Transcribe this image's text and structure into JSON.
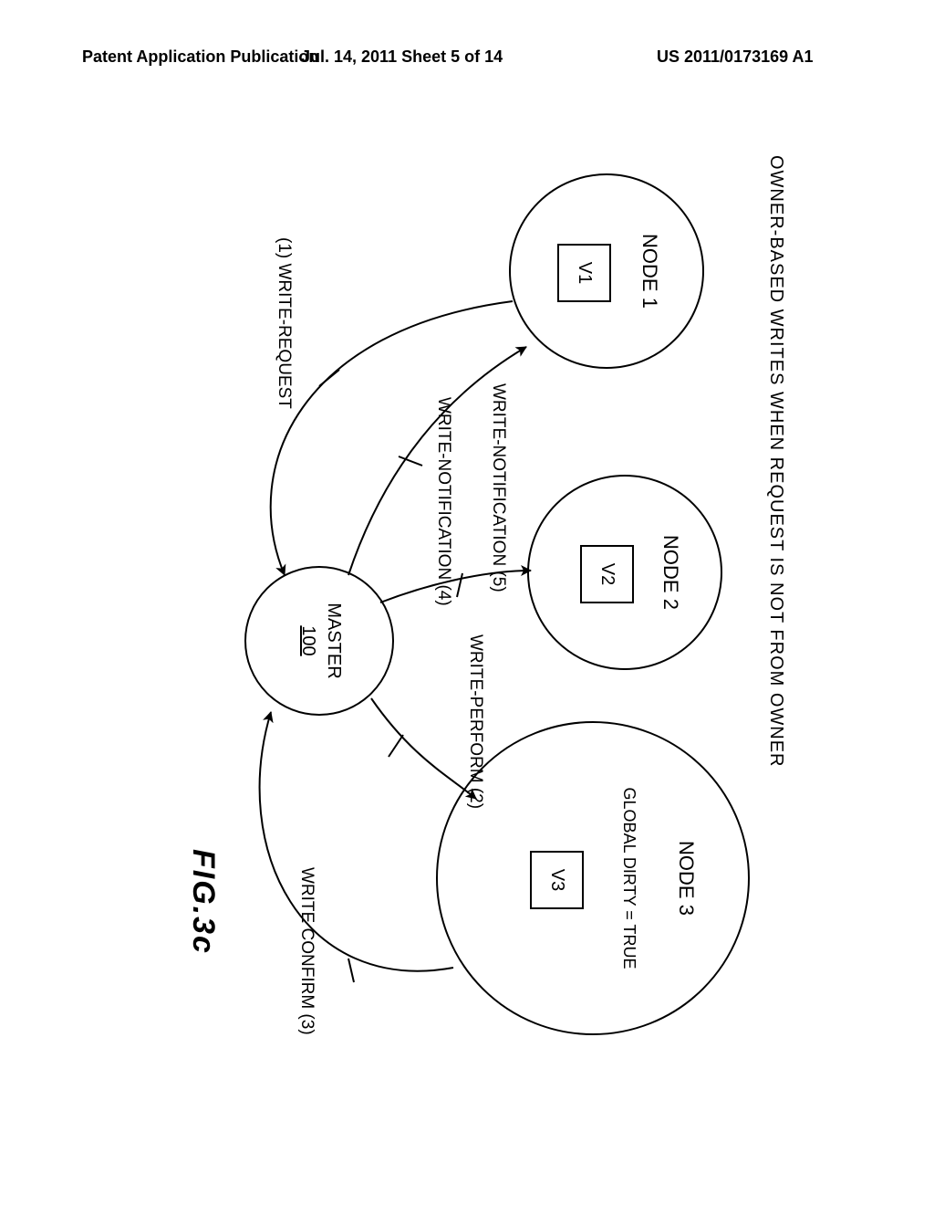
{
  "header": {
    "left": "Patent Application Publication",
    "middle": "Jul. 14, 2011   Sheet 5 of 14",
    "right": "US 2011/0173169 A1"
  },
  "diagram": {
    "caption": "OWNER-BASED WRITES WHEN REQUEST IS NOT FROM OWNER",
    "figure_label": "FIG.3c",
    "master": {
      "label": "MASTER",
      "ref": "100"
    },
    "nodes": {
      "n1": {
        "label": "NODE 1",
        "version": "V1"
      },
      "n2": {
        "label": "NODE 2",
        "version": "V2"
      },
      "n3": {
        "label": "NODE 3",
        "version": "V3",
        "dirty": "GLOBAL DIRTY = TRUE"
      }
    },
    "edges": {
      "write_request": "(1) WRITE-REQUEST",
      "write_perform": "WRITE-PERFORM (2)",
      "write_confirm": "WRITE CONFIRM (3)",
      "write_notif4": "WRITE-NOTIFICATION (4)",
      "write_notif5": "WRITE-NOTIFICATION (5)"
    }
  }
}
